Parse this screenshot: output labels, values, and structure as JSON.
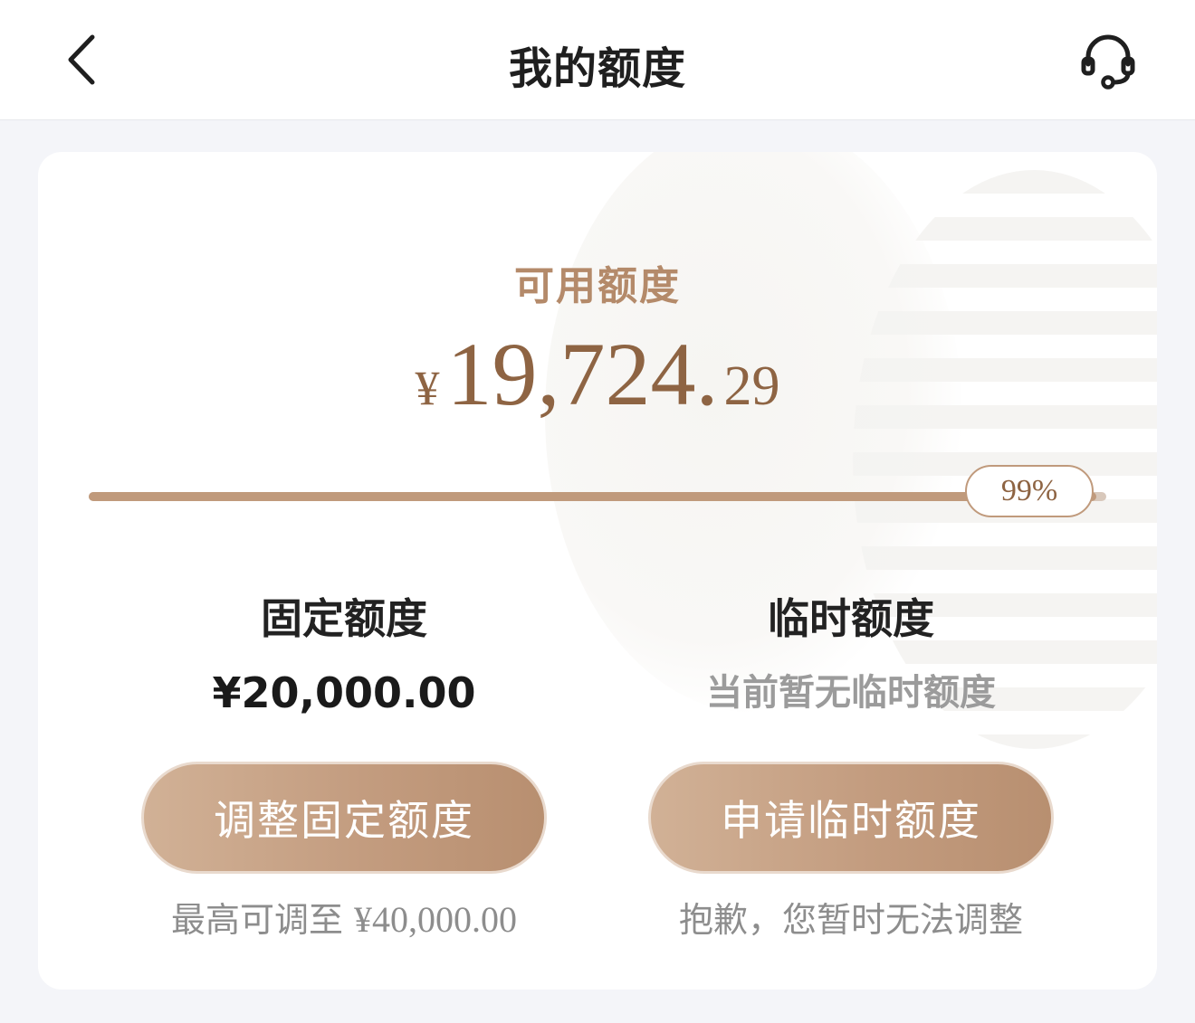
{
  "header": {
    "title": "我的额度",
    "back_icon": "chevron-left-icon",
    "service_icon": "headset-icon"
  },
  "summary": {
    "available_label": "可用额度",
    "currency": "¥",
    "amount_integer": "19,724.",
    "amount_decimal": "29",
    "usage_percent_label": "99%",
    "usage_fraction": 0.99
  },
  "fixed": {
    "title": "固定额度",
    "value": "¥20,000.00",
    "button_label": "调整固定额度",
    "note_prefix": "最高可调至",
    "note_amount": "¥40,000.00"
  },
  "temporary": {
    "title": "临时额度",
    "value": "当前暂无临时额度",
    "button_label": "申请临时额度",
    "note": "抱歉，您暂时无法调整"
  },
  "colors": {
    "accent": "#b48a6a",
    "amount": "#8e6443",
    "button_start": "#d1b196",
    "button_end": "#b88f70"
  }
}
